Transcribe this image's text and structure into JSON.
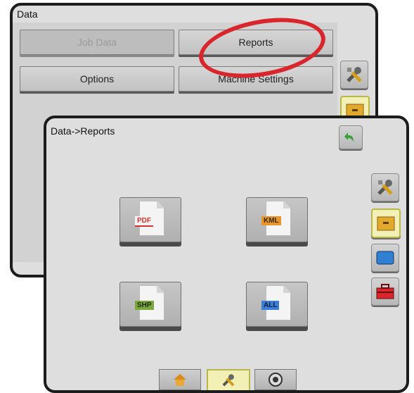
{
  "back_screen": {
    "title": "Data",
    "buttons": {
      "job_data": "Job Data",
      "reports": "Reports",
      "options": "Options",
      "machine_settings": "Machine Settings"
    },
    "highlight_color": "#d8262c"
  },
  "front_screen": {
    "title": "Data->Reports",
    "files": [
      {
        "tag": "PDF",
        "color": "#d8322c"
      },
      {
        "tag": "KML",
        "color": "#e8962c"
      },
      {
        "tag": "SHP",
        "color": "#7aa83c"
      },
      {
        "tag": "ALL",
        "color": "#3a7ed8"
      }
    ]
  },
  "icons": {
    "back": "back-arrow-icon",
    "tools": "tools-icon",
    "data": "drawer-icon",
    "screen": "screen-icon",
    "toolbox": "toolbox-icon",
    "home": "home-icon",
    "gauge": "gauge-icon"
  }
}
